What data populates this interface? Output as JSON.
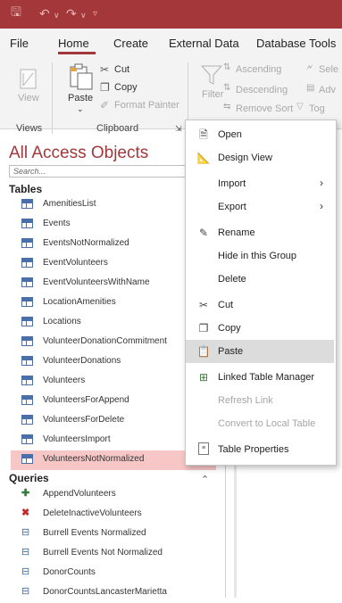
{
  "quick_access": {
    "save_icon": "save-icon",
    "undo_icon": "undo-icon",
    "redo_icon": "redo-icon",
    "customize_icon": "customize-icon"
  },
  "tabs": [
    "File",
    "Home",
    "Create",
    "External Data",
    "Database Tools"
  ],
  "ribbon": {
    "view_label": "View",
    "paste_label": "Paste",
    "cut_label": "Cut",
    "copy_label": "Copy",
    "format_painter_label": "Format Painter",
    "filter_label": "Filter",
    "ascending_label": "Ascending",
    "descending_label": "Descending",
    "remove_sort_label": "Remove Sort",
    "select_partial": "Sele",
    "advanced_partial": "Adv",
    "toggle_partial": "Tog",
    "groups": {
      "views": "Views",
      "clipboard": "Clipboard"
    }
  },
  "nav": {
    "title": "All Access Objects",
    "search_placeholder": "Search...",
    "tables_header": "Tables",
    "queries_header": "Queries",
    "tables": [
      "AmenitiesList",
      "Events",
      "EventsNotNormalized",
      "EventVolunteers",
      "EventVolunteersWithName",
      "LocationAmenities",
      "Locations",
      "VolunteerDonationCommitment",
      "VolunteerDonations",
      "Volunteers",
      "VolunteersForAppend",
      "VolunteersForDelete",
      "VolunteersImport",
      "VolunteersNotNormalized"
    ],
    "selected_table": "VolunteersNotNormalized",
    "queries": [
      "AppendVolunteers",
      "DeleteInactiveVolunteers",
      "Burrell Events Normalized",
      "Burrell Events Not Normalized",
      "DonorCounts",
      "DonorCountsLancasterMarietta"
    ]
  },
  "context_menu": {
    "open": "Open",
    "design_view": "Design View",
    "import": "Import",
    "export": "Export",
    "rename": "Rename",
    "hide": "Hide in this Group",
    "delete": "Delete",
    "cut": "Cut",
    "copy": "Copy",
    "paste": "Paste",
    "linked_table_manager": "Linked Table Manager",
    "refresh_link": "Refresh Link",
    "convert": "Convert to Local Table",
    "table_properties": "Table Properties"
  },
  "colors": {
    "accent": "#a4373a",
    "selected_row": "#f7c6c7",
    "menu_highlight": "#dcdcdc"
  }
}
